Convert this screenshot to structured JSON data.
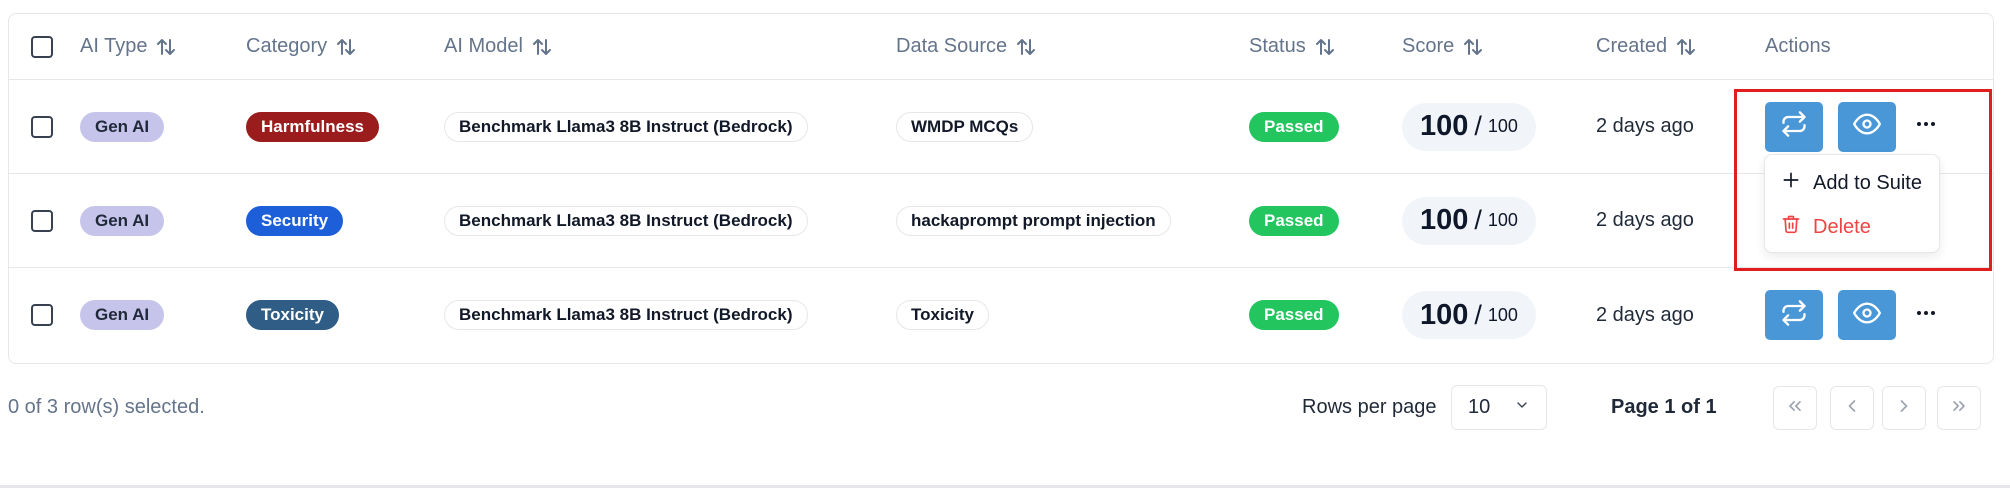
{
  "table": {
    "headers": {
      "ai_type": "AI Type",
      "category": "Category",
      "ai_model": "AI Model",
      "data_source": "Data Source",
      "status": "Status",
      "score": "Score",
      "created": "Created",
      "actions": "Actions"
    },
    "rows": [
      {
        "ai_type": "Gen AI",
        "category": "Harmfulness",
        "category_color": "#9b1c1c",
        "ai_model": "Benchmark Llama3 8B Instruct (Bedrock)",
        "data_source": "WMDP MCQs",
        "status": "Passed",
        "score": "100",
        "score_sep": "/",
        "score_max": "100",
        "created": "2 days ago"
      },
      {
        "ai_type": "Gen AI",
        "category": "Security",
        "category_color": "#1d5fd9",
        "ai_model": "Benchmark Llama3 8B Instruct (Bedrock)",
        "data_source": "hackaprompt prompt injection",
        "status": "Passed",
        "score": "100",
        "score_sep": "/",
        "score_max": "100",
        "created": "2 days ago"
      },
      {
        "ai_type": "Gen AI",
        "category": "Toxicity",
        "category_color": "#2f5d86",
        "ai_model": "Benchmark Llama3 8B Instruct (Bedrock)",
        "data_source": "Toxicity",
        "status": "Passed",
        "score": "100",
        "score_sep": "/",
        "score_max": "100",
        "created": "2 days ago"
      }
    ]
  },
  "actions_menu": {
    "add_to_suite": "Add to Suite",
    "delete": "Delete"
  },
  "footer": {
    "selection": "0 of 3 row(s) selected.",
    "rows_per_page_label": "Rows per page",
    "rows_per_page_value": "10",
    "page_info": "Page 1 of 1"
  },
  "colors": {
    "action_button": "#4a97d8",
    "passed": "#22c55e",
    "highlight": "#e11d1d",
    "delete": "#ef4444"
  }
}
